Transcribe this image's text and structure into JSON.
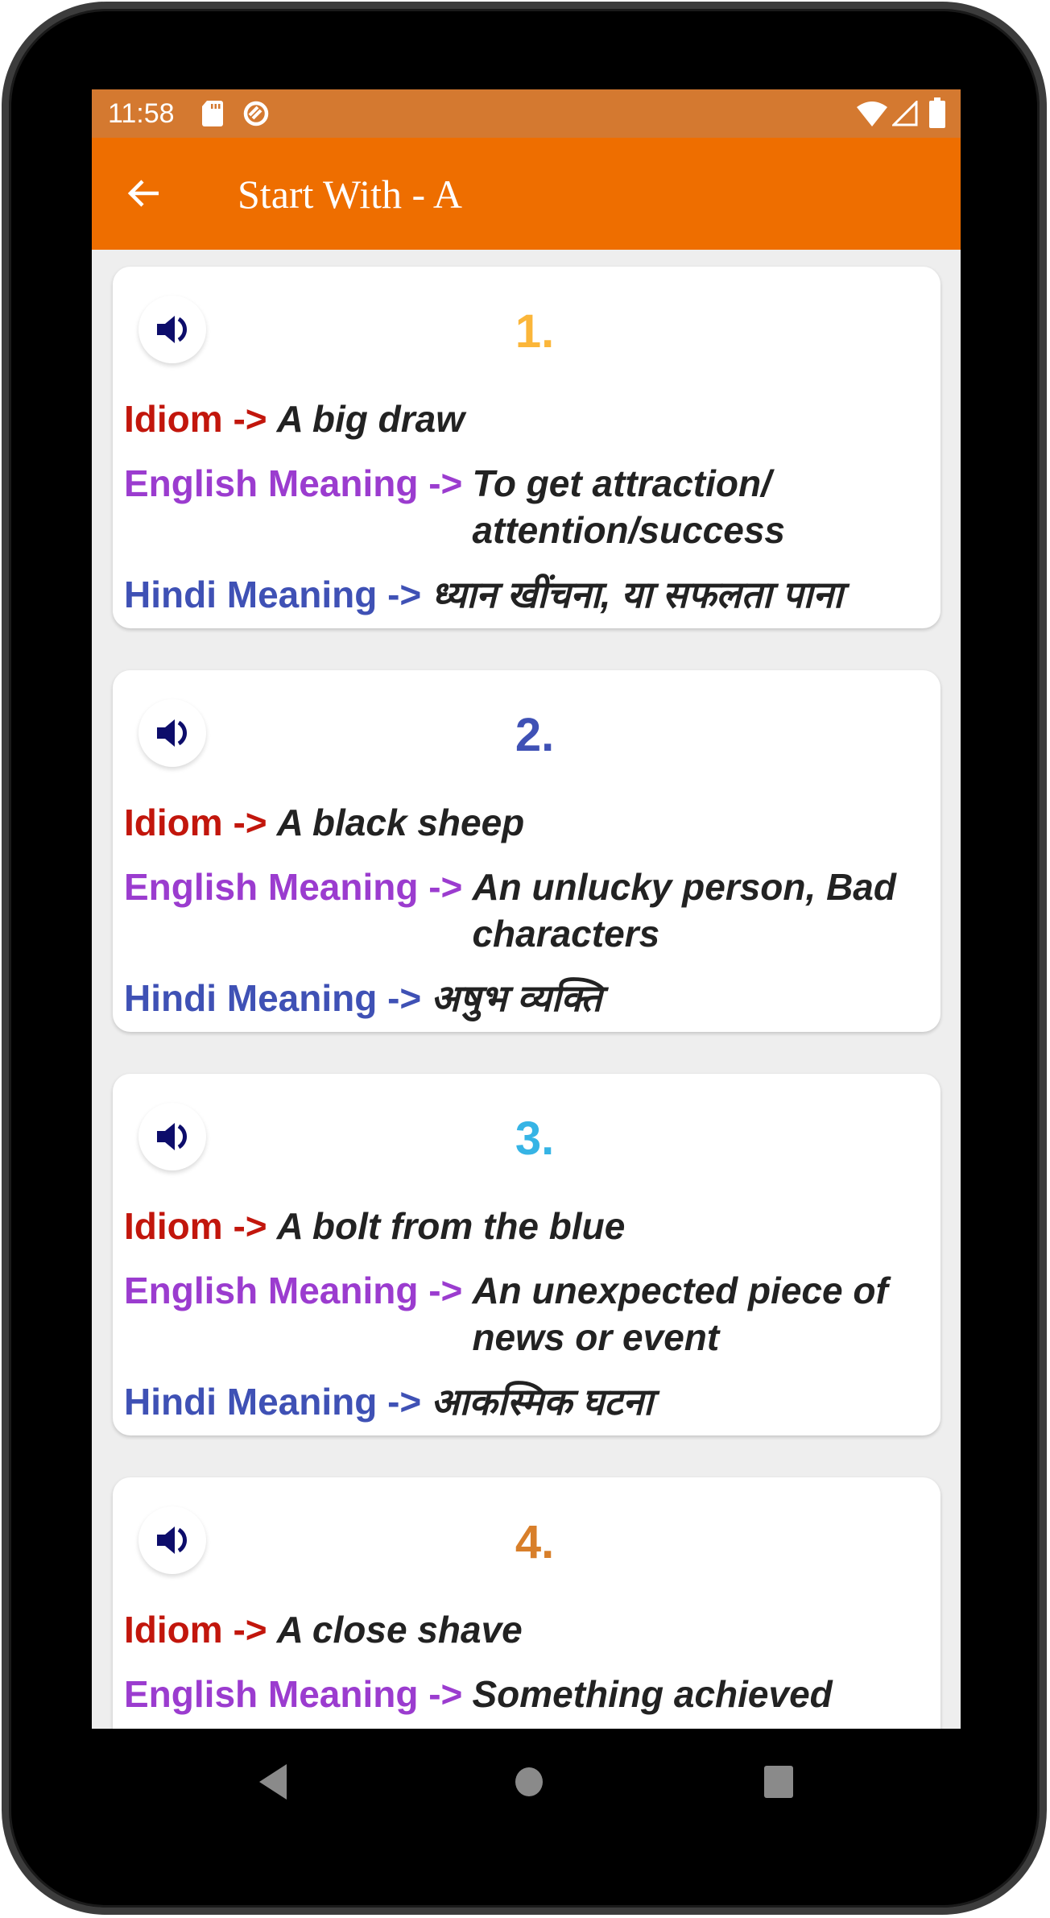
{
  "status_bar": {
    "time": "11:58",
    "left_icons": [
      "sd-card-icon",
      "data-saver-icon"
    ],
    "right_icons": [
      "wifi-icon",
      "signal-icon",
      "battery-icon"
    ]
  },
  "toolbar": {
    "back_icon": "arrow-back-icon",
    "title": "Start With - A"
  },
  "colors": {
    "status_bar": "#d47930",
    "toolbar": "#ee6e00",
    "idiom_label": "#c2160c",
    "english_label": "#9b3ccf",
    "hindi_label": "#3f51b5",
    "speaker_icon": "#0d0d6b"
  },
  "labels": {
    "idiom": "Idiom ->",
    "english": "English Meaning ->",
    "hindi": "Hindi Meaning ->"
  },
  "items": [
    {
      "number": "1.",
      "number_color": "#fbb63a",
      "idiom": "A big draw",
      "english": "To get attraction/ attention/success",
      "hindi": "ध्यान खींचना, या सफलता पाना"
    },
    {
      "number": "2.",
      "number_color": "#3f51b5",
      "idiom": "A black sheep",
      "english": "An unlucky person, Bad characters",
      "hindi": "अषुभ व्यक्ति"
    },
    {
      "number": "3.",
      "number_color": "#36b4e5",
      "idiom": "A bolt from the blue",
      "english": "An unexpected piece of news or event",
      "hindi": "आकस्मिक घटना"
    },
    {
      "number": "4.",
      "number_color": "#d87f2a",
      "idiom": "A close shave",
      "english": "Something achieved",
      "hindi": ""
    }
  ],
  "nav_bar": {
    "buttons": [
      "back-nav",
      "home-nav",
      "recents-nav"
    ]
  }
}
